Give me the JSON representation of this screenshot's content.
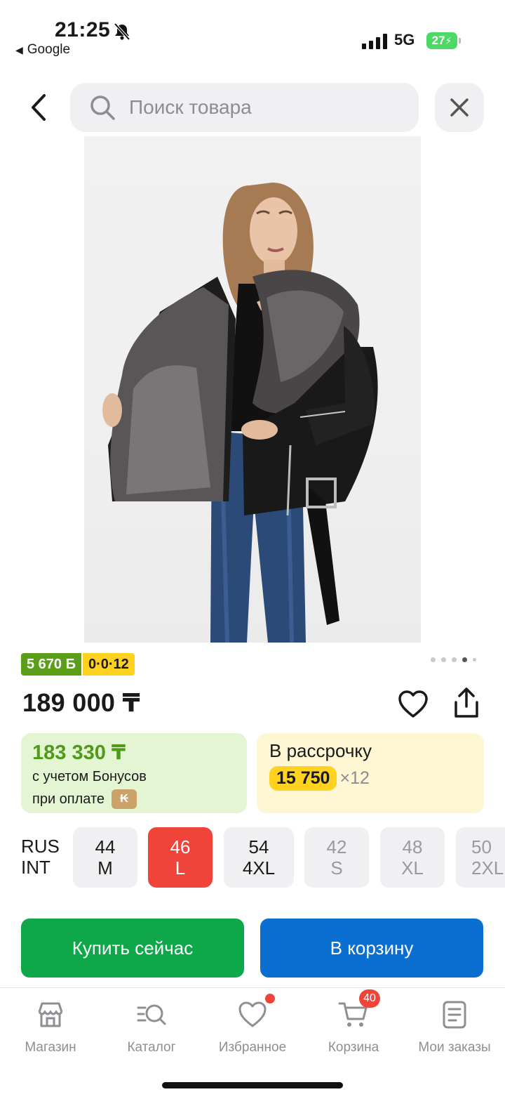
{
  "status_bar": {
    "time": "21:25",
    "back_app": "Google",
    "network": "5G",
    "battery": "27"
  },
  "search": {
    "placeholder": "Поиск товара"
  },
  "badges": {
    "bonus": "5 670 Б",
    "installment": "0·0·12"
  },
  "gallery": {
    "total": 5,
    "active_index": 3
  },
  "price": "189 000 ₸",
  "bonus_card": {
    "value": "183 330 ₸",
    "line1": "с учетом Бонусов",
    "line2": "при оплате"
  },
  "installment_card": {
    "title": "В рассрочку",
    "amount": "15 750",
    "multiplier": "×12"
  },
  "sizes": {
    "label_rus": "RUS",
    "label_int": "INT",
    "items": [
      {
        "rus": "44",
        "int": "M",
        "state": "available"
      },
      {
        "rus": "46",
        "int": "L",
        "state": "selected"
      },
      {
        "rus": "54",
        "int": "4XL",
        "state": "available"
      },
      {
        "rus": "42",
        "int": "S",
        "state": "unavailable"
      },
      {
        "rus": "48",
        "int": "XL",
        "state": "unavailable"
      },
      {
        "rus": "50",
        "int": "2XL",
        "state": "unavailable"
      }
    ]
  },
  "actions": {
    "buy_now": "Купить сейчас",
    "add_to_cart": "В корзину"
  },
  "nav": {
    "items": [
      {
        "label": "Магазин",
        "icon": "shop-icon"
      },
      {
        "label": "Каталог",
        "icon": "catalog-search-icon"
      },
      {
        "label": "Избранное",
        "icon": "heart-icon"
      },
      {
        "label": "Корзина",
        "icon": "cart-icon",
        "badge": "40"
      },
      {
        "label": "Мои заказы",
        "icon": "orders-icon"
      }
    ]
  },
  "colors": {
    "accent_red": "#f0443a",
    "buy_green": "#0ea84b",
    "cart_blue": "#0a6fd0",
    "bonus_green": "#5a9e1a",
    "installment_yellow": "#ffd21f"
  }
}
